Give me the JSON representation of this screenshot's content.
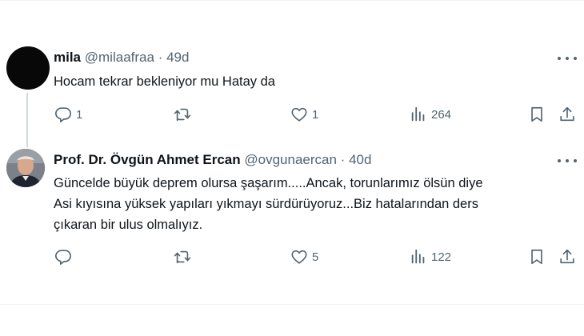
{
  "tweets": [
    {
      "name": "mila",
      "handle": "@milaafraa",
      "separator": "·",
      "time": "49d",
      "text": "Hocam tekrar bekleniyor mu Hatay da",
      "avatar_color": "#080808",
      "actions": {
        "replies": "1",
        "retweets": "",
        "likes": "1",
        "views": "264"
      }
    },
    {
      "name": "Prof. Dr. Övgün Ahmet Ercan",
      "handle": "@ovgunaercan",
      "separator": "·",
      "time": "40d",
      "text_lines": [
        "Güncelde büyük deprem olursa şaşarım.....Ancak, torunlarımız ölsün diye",
        "Asi kıyısına yüksek yapıları yıkmayı sürdürüyoruz...Biz hatalarından ders",
        "çıkaran bir ulus olmalıyız."
      ],
      "actions": {
        "replies": "",
        "retweets": "",
        "likes": "5",
        "views": "122"
      }
    }
  ],
  "icons": {
    "reply": "reply-icon",
    "retweet": "retweet-icon",
    "like": "heart-icon",
    "views": "views-icon",
    "bookmark": "bookmark-icon",
    "share": "share-icon",
    "more": "more-icon"
  },
  "colors": {
    "text": "#0f1419",
    "secondary": "#536471",
    "thread_line": "#cfd9de",
    "divider": "#eff3f4"
  }
}
